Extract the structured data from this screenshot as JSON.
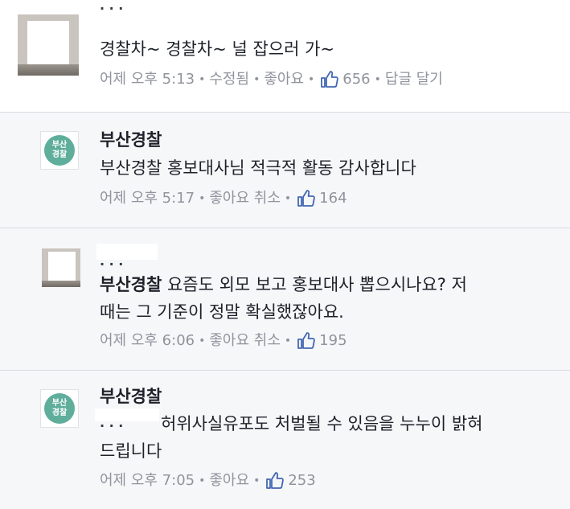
{
  "comments": [
    {
      "author": "",
      "body": "경찰차~ 경찰차~ 널 잡으러 가~",
      "time": "어제 오후 5:13",
      "edited": "수정됨",
      "like": "좋아요",
      "like_count": "656",
      "reply": "답글 달기"
    },
    {
      "author": "부산경찰",
      "body": "부산경찰 홍보대사님 적극적 활동 감사합니다",
      "time": "어제 오후 5:17",
      "like": "좋아요 취소",
      "like_count": "164"
    },
    {
      "author": "",
      "mention": "부산경찰",
      "body_line1": " 요즘도 외모 보고 홍보대사 뽑으시나요? 저",
      "body_line2": "때는 그 기준이 정말 확실했잖아요.",
      "time": "어제 오후 6:06",
      "like": "좋아요 취소",
      "like_count": "195"
    },
    {
      "author": "부산경찰",
      "body_line1": "허위사실유포도 처벌될 수 있음을 누누이 밝혀",
      "body_line2": "드립니다",
      "time": "어제 오후 7:05",
      "like": "좋아요",
      "like_count": "253"
    }
  ],
  "avatar_badge": {
    "line1": "부산",
    "line2": "경찰"
  },
  "icons": {
    "like": "thumbs-up-icon"
  },
  "colors": {
    "meta": "#90949c",
    "like_icon": "#4267b2",
    "badge": "#5fae9c",
    "text": "#1d2129"
  }
}
